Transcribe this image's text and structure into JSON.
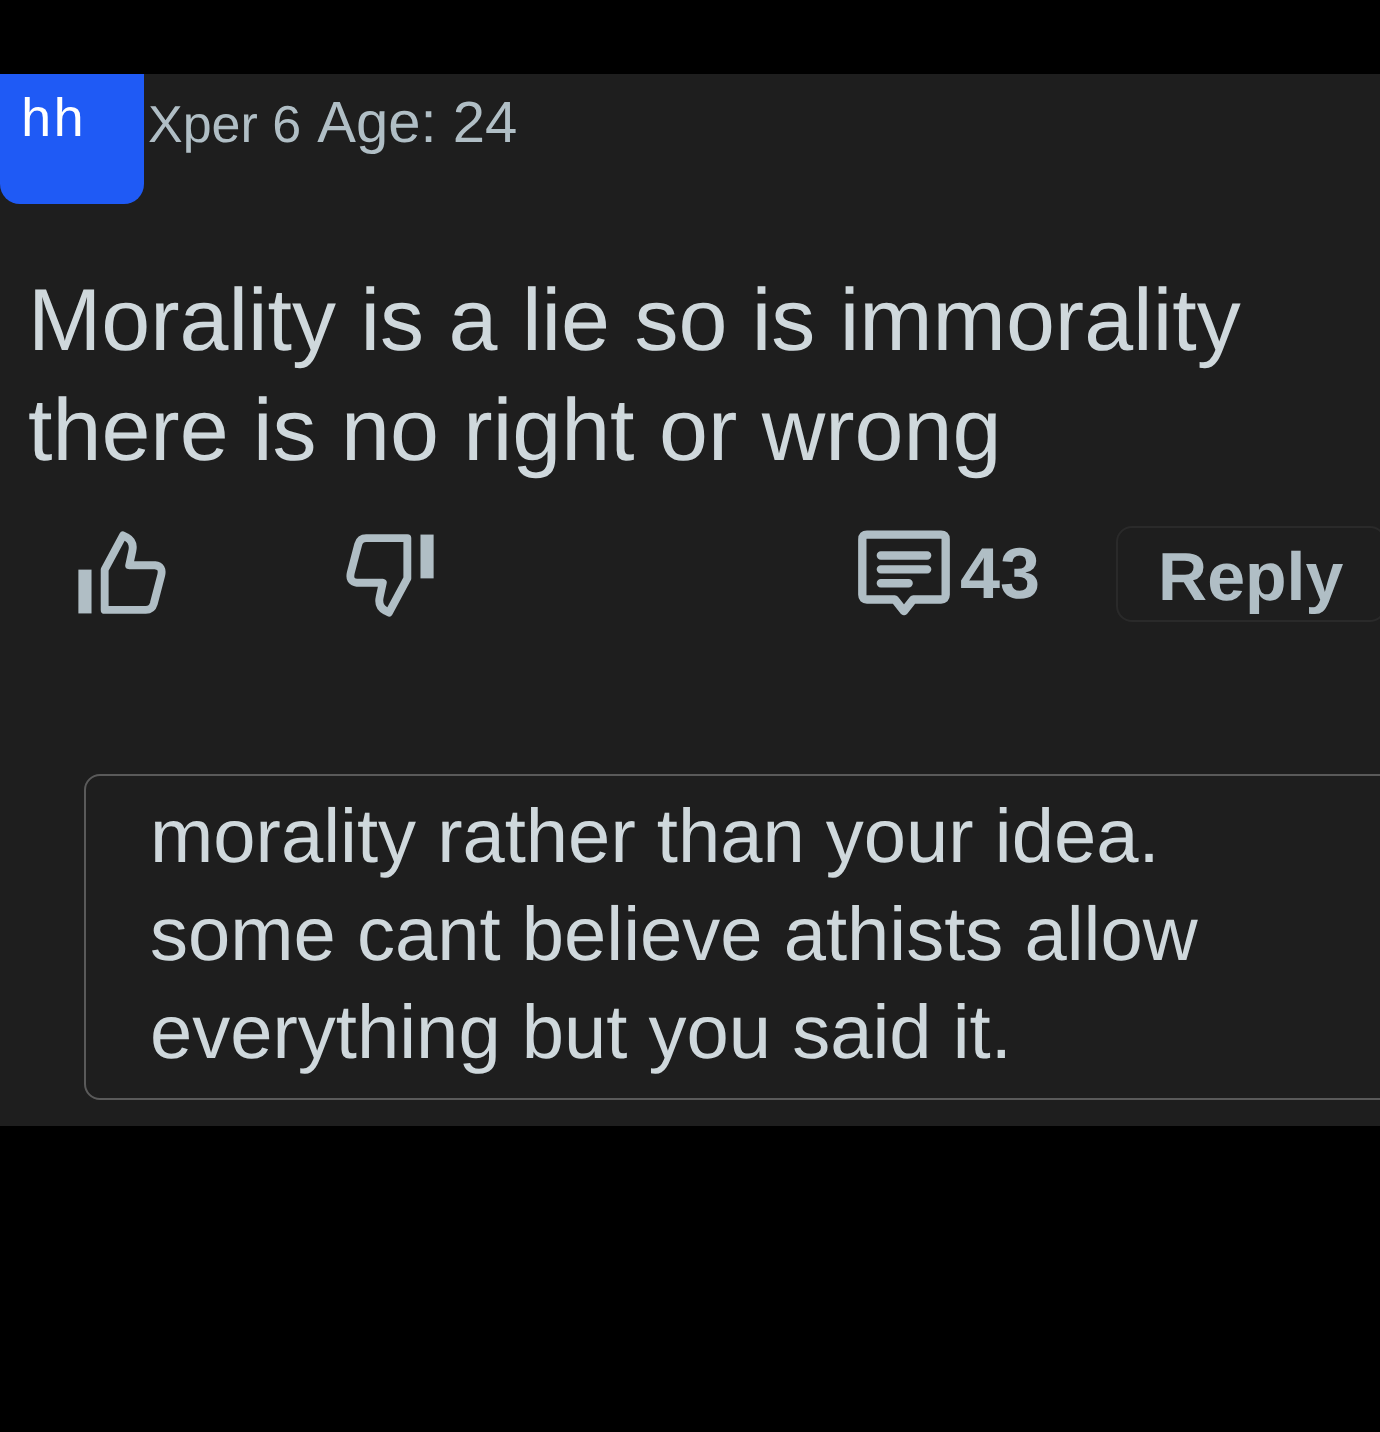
{
  "comment": {
    "avatar_initials": "hh",
    "author": "Xper 6",
    "age": "Age: 24",
    "body": "Morality is a lie so is immorality there is no right or wrong"
  },
  "actions": {
    "comment_count": "43",
    "reply": "Reply"
  },
  "quoted_reply": {
    "text": "morality rather than your idea. some cant believe athists allow everything but you said it."
  }
}
